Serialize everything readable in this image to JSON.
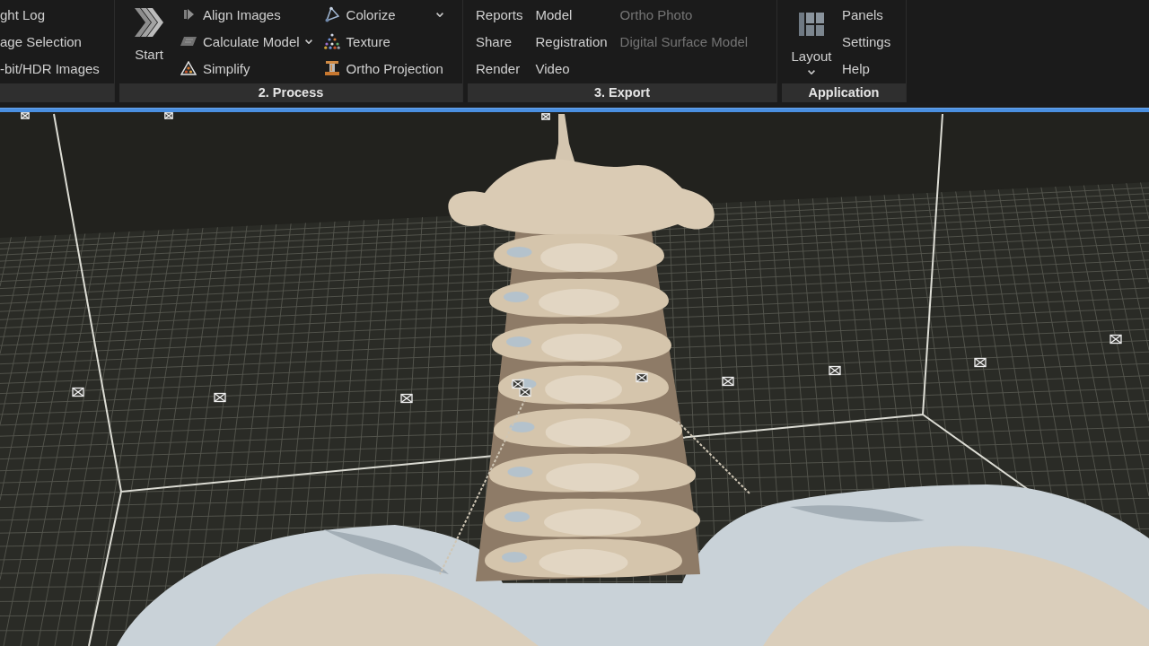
{
  "ribbon": {
    "groups": [
      {
        "columns": [
          [
            {
              "kind": "small",
              "label": "ght Log",
              "disabled": false
            },
            {
              "kind": "small",
              "label": "age Selection",
              "disabled": false
            },
            {
              "kind": "small",
              "label": "-bit/HDR Images",
              "disabled": false
            }
          ]
        ]
      },
      {
        "label": "2. Process",
        "columns": [
          [
            {
              "kind": "large",
              "label": "Start",
              "disabled": false
            }
          ],
          [
            {
              "kind": "small",
              "label": "Align Images",
              "disabled": false
            },
            {
              "kind": "small",
              "label": "Calculate Model",
              "disabled": false
            },
            {
              "kind": "small",
              "label": "Simplify",
              "disabled": false
            }
          ],
          [
            {
              "kind": "small",
              "label": "Colorize",
              "disabled": false
            },
            {
              "kind": "small",
              "label": "Texture",
              "disabled": false
            },
            {
              "kind": "small",
              "label": "Ortho Projection",
              "disabled": false
            }
          ]
        ]
      },
      {
        "label": "3. Export",
        "columns": [
          [
            {
              "kind": "small",
              "label": "Reports",
              "disabled": false
            },
            {
              "kind": "small",
              "label": "Share",
              "disabled": false
            },
            {
              "kind": "small",
              "label": "Render",
              "disabled": false
            }
          ],
          [
            {
              "kind": "small",
              "label": "Model",
              "disabled": false
            },
            {
              "kind": "small",
              "label": "Registration",
              "disabled": false
            },
            {
              "kind": "small",
              "label": "Video",
              "disabled": false
            }
          ],
          [
            {
              "kind": "small",
              "label": "Ortho Photo",
              "disabled": true
            },
            {
              "kind": "small",
              "label": "Digital Surface Model",
              "disabled": true
            }
          ]
        ]
      },
      {
        "label": "Application",
        "columns": [
          [
            {
              "kind": "large",
              "label": "Layout",
              "disabled": false
            }
          ],
          [
            {
              "kind": "small",
              "label": "Panels",
              "disabled": false
            },
            {
              "kind": "small",
              "label": "Settings",
              "disabled": false
            },
            {
              "kind": "small",
              "label": "Help",
              "disabled": false
            }
          ]
        ]
      }
    ]
  }
}
